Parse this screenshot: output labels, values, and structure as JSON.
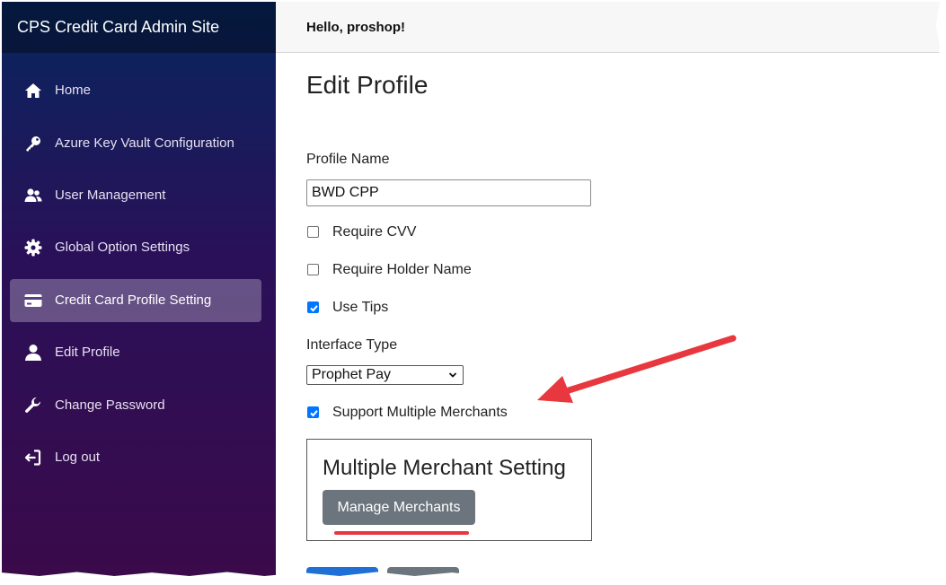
{
  "brand": {
    "title": "CPS Credit Card Admin Site"
  },
  "sidebar": {
    "items": [
      {
        "label": "Home",
        "icon": "home-icon"
      },
      {
        "label": "Azure Key Vault Configuration",
        "icon": "key-icon"
      },
      {
        "label": "User Management",
        "icon": "users-icon"
      },
      {
        "label": "Global Option Settings",
        "icon": "gear-icon"
      },
      {
        "label": "Credit Card Profile Setting",
        "icon": "credit-card-icon",
        "active": true
      },
      {
        "label": "Edit Profile",
        "icon": "user-icon"
      },
      {
        "label": "Change Password",
        "icon": "wrench-icon"
      },
      {
        "label": "Log out",
        "icon": "logout-icon"
      }
    ]
  },
  "header": {
    "greeting": "Hello, proshop!"
  },
  "form": {
    "title": "Edit Profile",
    "profile_name_label": "Profile Name",
    "profile_name_value": "BWD CPP",
    "require_cvv": {
      "label": "Require CVV",
      "checked": false
    },
    "require_holder_name": {
      "label": "Require Holder Name",
      "checked": false
    },
    "use_tips": {
      "label": "Use Tips",
      "checked": true
    },
    "interface_type_label": "Interface Type",
    "interface_type_value": "Prophet Pay",
    "support_multiple_merchants": {
      "label": "Support Multiple Merchants",
      "checked": true
    },
    "multiple_merchant": {
      "heading": "Multiple Merchant Setting",
      "manage_button": "Manage Merchants"
    }
  },
  "colors": {
    "accent_checkbox": "#0075ff",
    "annotation_red": "#e8373e",
    "secondary_button": "#6c757d",
    "primary_button": "#1f6fd6"
  }
}
